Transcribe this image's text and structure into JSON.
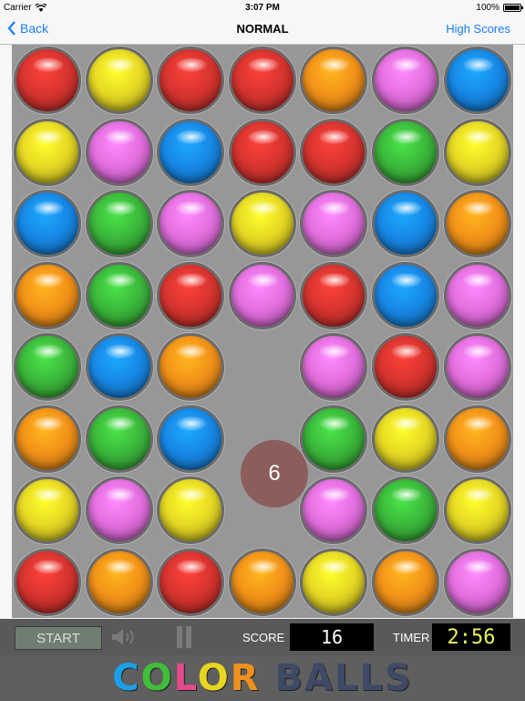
{
  "status_bar": {
    "carrier": "Carrier",
    "time": "3:07 PM",
    "battery": "100%",
    "battery_level": 1.0
  },
  "nav": {
    "back_label": "Back",
    "title": "NORMAL",
    "high_scores_label": "High Scores"
  },
  "colors": {
    "red": "#d7342f",
    "yellow": "#e7d924",
    "orange": "#f39219",
    "pink": "#e46fe0",
    "blue": "#1788e6",
    "green": "#3bb83b"
  },
  "board": {
    "rows": [
      [
        "red",
        "yellow",
        "red",
        "red",
        "orange",
        "pink",
        "blue"
      ],
      [
        "yellow",
        "pink",
        "blue",
        "red",
        "red",
        "green",
        "yellow"
      ],
      [
        "blue",
        "green",
        "pink",
        "yellow",
        "pink",
        "blue",
        "orange"
      ],
      [
        "orange",
        "green",
        "red",
        "pink",
        "red",
        "blue",
        "pink"
      ],
      [
        "green",
        "blue",
        "orange",
        "empty",
        "pink",
        "red",
        "pink"
      ],
      [
        "orange",
        "green",
        "blue",
        "empty",
        "green",
        "yellow",
        "orange"
      ],
      [
        "yellow",
        "pink",
        "yellow",
        "empty",
        "pink",
        "green",
        "yellow"
      ],
      [
        "red",
        "orange",
        "red",
        "orange",
        "yellow",
        "orange",
        "pink"
      ]
    ],
    "counter": "6"
  },
  "controls": {
    "start_label": "START",
    "score_label": "SCORE",
    "score_value": "16",
    "timer_label": "TIMER",
    "timer_value": "2:56"
  },
  "logo": {
    "letters": [
      {
        "char": "C",
        "color": "#1aa0e8"
      },
      {
        "char": "O",
        "color": "#3fbf3a"
      },
      {
        "char": "L",
        "color": "#e64a8c"
      },
      {
        "char": "O",
        "color": "#e8d620"
      },
      {
        "char": "R",
        "color": "#f0901c"
      },
      {
        "char": " ",
        "color": "#ffffff"
      },
      {
        "char": "B",
        "color": "#3e4a66"
      },
      {
        "char": "A",
        "color": "#3e4a66"
      },
      {
        "char": "L",
        "color": "#3e4a66"
      },
      {
        "char": "L",
        "color": "#3e4a66"
      },
      {
        "char": "S",
        "color": "#3e4a66"
      }
    ]
  }
}
